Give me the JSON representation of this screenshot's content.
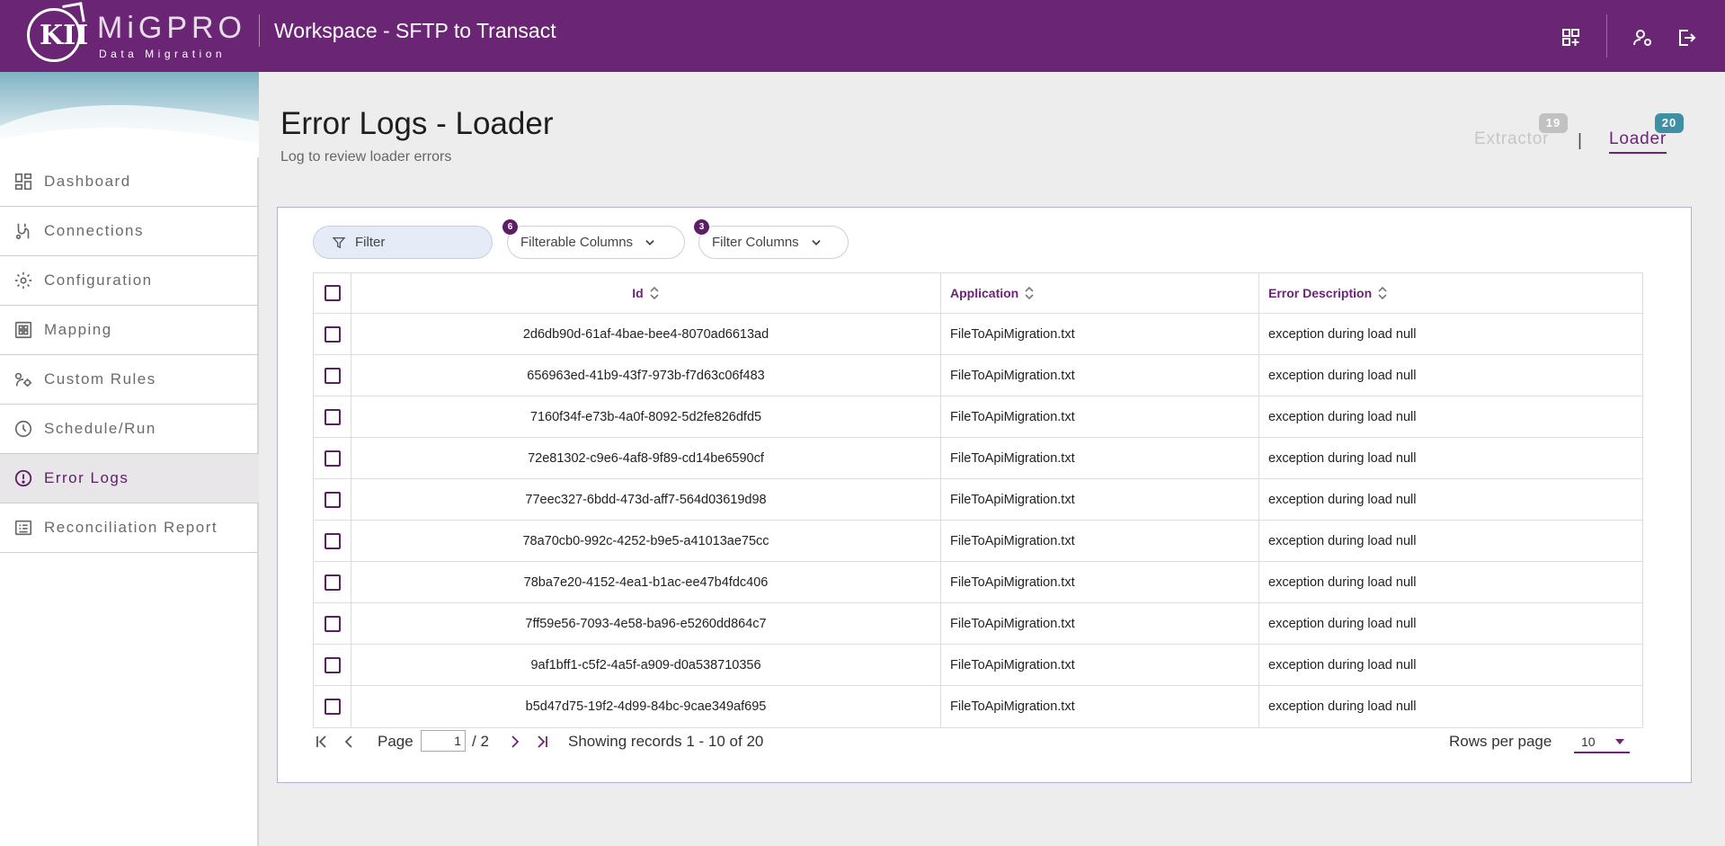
{
  "header": {
    "brand_name": "MiGPRO",
    "brand_sub": "Data Migration",
    "logo_letters": "KII",
    "workspace_title": "Workspace - SFTP to Transact",
    "icons": [
      "add-widget-icon",
      "user-settings-icon",
      "logout-icon"
    ]
  },
  "sidebar": {
    "items": [
      {
        "label": "Dashboard",
        "icon": "dashboard-icon"
      },
      {
        "label": "Connections",
        "icon": "connections-icon"
      },
      {
        "label": "Configuration",
        "icon": "gear-icon"
      },
      {
        "label": "Mapping",
        "icon": "mapping-icon"
      },
      {
        "label": "Custom Rules",
        "icon": "custom-rules-icon"
      },
      {
        "label": "Schedule/Run",
        "icon": "clock-icon"
      },
      {
        "label": "Error Logs",
        "icon": "alert-circle-icon",
        "active": true
      },
      {
        "label": "Reconciliation Report",
        "icon": "report-icon"
      }
    ]
  },
  "page": {
    "title": "Error Logs - Loader",
    "subtitle": "Log to review loader errors",
    "tabs": [
      {
        "label": "Extractor",
        "count": "19"
      },
      {
        "label": "Loader",
        "count": "20",
        "active": true
      }
    ],
    "tab_separator": "|"
  },
  "toolbar": {
    "filter_placeholder": "Filter",
    "filterable_columns_label": "Filterable Columns",
    "filterable_columns_count": "6",
    "filter_columns_label": "Filter Columns",
    "filter_columns_count": "3"
  },
  "table": {
    "columns": [
      "Id",
      "Application",
      "Error Description"
    ],
    "rows": [
      {
        "id": "2d6db90d-61af-4bae-bee4-8070ad6613ad",
        "application": "FileToApiMigration.txt",
        "error": "exception during load null"
      },
      {
        "id": "656963ed-41b9-43f7-973b-f7d63c06f483",
        "application": "FileToApiMigration.txt",
        "error": "exception during load null"
      },
      {
        "id": "7160f34f-e73b-4a0f-8092-5d2fe826dfd5",
        "application": "FileToApiMigration.txt",
        "error": "exception during load null"
      },
      {
        "id": "72e81302-c9e6-4af8-9f89-cd14be6590cf",
        "application": "FileToApiMigration.txt",
        "error": "exception during load null"
      },
      {
        "id": "77eec327-6bdd-473d-aff7-564d03619d98",
        "application": "FileToApiMigration.txt",
        "error": "exception during load null"
      },
      {
        "id": "78a70cb0-992c-4252-b9e5-a41013ae75cc",
        "application": "FileToApiMigration.txt",
        "error": "exception during load null"
      },
      {
        "id": "78ba7e20-4152-4ea1-b1ac-ee47b4fdc406",
        "application": "FileToApiMigration.txt",
        "error": "exception during load null"
      },
      {
        "id": "7ff59e56-7093-4e58-ba96-e5260dd864c7",
        "application": "FileToApiMigration.txt",
        "error": "exception during load null"
      },
      {
        "id": "9af1bff1-c5f2-4a5f-a909-d0a538710356",
        "application": "FileToApiMigration.txt",
        "error": "exception during load null"
      },
      {
        "id": "b5d47d75-19f2-4d99-84bc-9cae349af695",
        "application": "FileToApiMigration.txt",
        "error": "exception during load null"
      }
    ]
  },
  "pager": {
    "page_label": "Page",
    "current_page": "1",
    "total_pages": "/ 2",
    "records_text": "Showing records 1 - 10 of 20",
    "rows_per_page_label": "Rows per page",
    "rows_per_page_value": "10"
  },
  "colors": {
    "brand": "#6a2575",
    "accent_badge_loader": "#3f8fa5",
    "badge_extractor": "#c1c1c1",
    "filter_bg": "#e6ecf7"
  }
}
